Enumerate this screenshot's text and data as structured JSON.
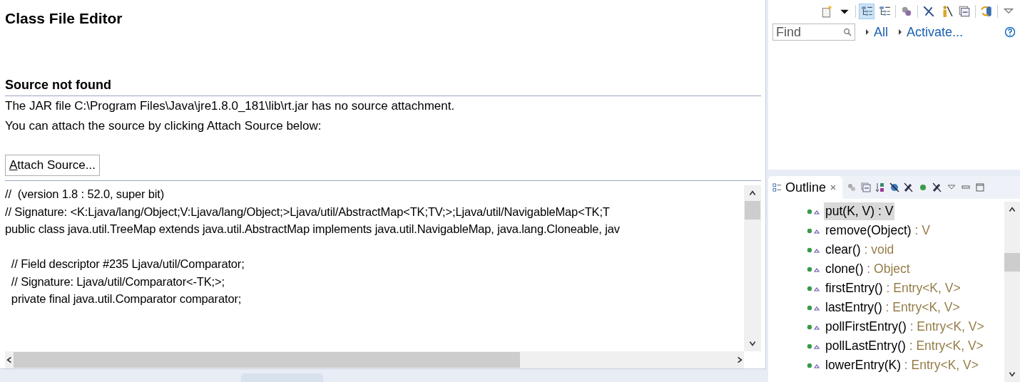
{
  "editor": {
    "title": "Class File Editor",
    "section_title": "Source not found",
    "messages": [
      "The JAR file C:\\Program Files\\Java\\jre1.8.0_181\\lib\\rt.jar has no source attachment.",
      "You can attach the source by clicking Attach Source below:"
    ],
    "attach_button": {
      "mnemonic": "A",
      "label": "ttach Source..."
    },
    "code_blocks": [
      [
        "//  (version 1.8 : 52.0, super bit)",
        "// Signature: <K:Ljava/lang/Object;V:Ljava/lang/Object;>Ljava/util/AbstractMap<TK;TV;>;Ljava/util/NavigableMap<TK;T",
        "public class java.util.TreeMap extends java.util.AbstractMap implements java.util.NavigableMap, java.lang.Cloneable, jav"
      ],
      [
        "  // Field descriptor #235 Ljava/util/Comparator;",
        "  // Signature: Ljava/util/Comparator<-TK;>;",
        "  private final java.util.Comparator comparator;"
      ]
    ]
  },
  "task_list": {
    "toolbar": [
      {
        "kind": "new-task",
        "selected": false
      },
      {
        "kind": "dropdown",
        "selected": false
      },
      {
        "kind": "categorized",
        "selected": true
      },
      {
        "kind": "scheduled",
        "selected": false
      },
      {
        "kind": "group",
        "selected": false
      },
      {
        "kind": "hide-completed",
        "selected": false
      },
      {
        "kind": "focus",
        "selected": false
      },
      {
        "kind": "collapse",
        "selected": false
      },
      {
        "kind": "sync",
        "selected": false
      },
      {
        "kind": "menu",
        "selected": false
      }
    ],
    "find": {
      "placeholder": "Find"
    },
    "links": [
      "All",
      "Activate..."
    ]
  },
  "outline": {
    "tab_label": "Outline",
    "items": [
      {
        "name": "put(K, V)",
        "type": " : V",
        "selected": true
      },
      {
        "name": "remove(Object)",
        "type": " : V",
        "selected": false
      },
      {
        "name": "clear()",
        "type": " : void",
        "selected": false
      },
      {
        "name": "clone()",
        "type": " : Object",
        "selected": false
      },
      {
        "name": "firstEntry()",
        "type": " : Entry<K, V>",
        "selected": false
      },
      {
        "name": "lastEntry()",
        "type": " : Entry<K, V>",
        "selected": false
      },
      {
        "name": "pollFirstEntry()",
        "type": " : Entry<K, V>",
        "selected": false
      },
      {
        "name": "pollLastEntry()",
        "type": " : Entry<K, V>",
        "selected": false
      },
      {
        "name": "lowerEntry(K)",
        "type": " : Entry<K, V>",
        "selected": false
      }
    ]
  }
}
